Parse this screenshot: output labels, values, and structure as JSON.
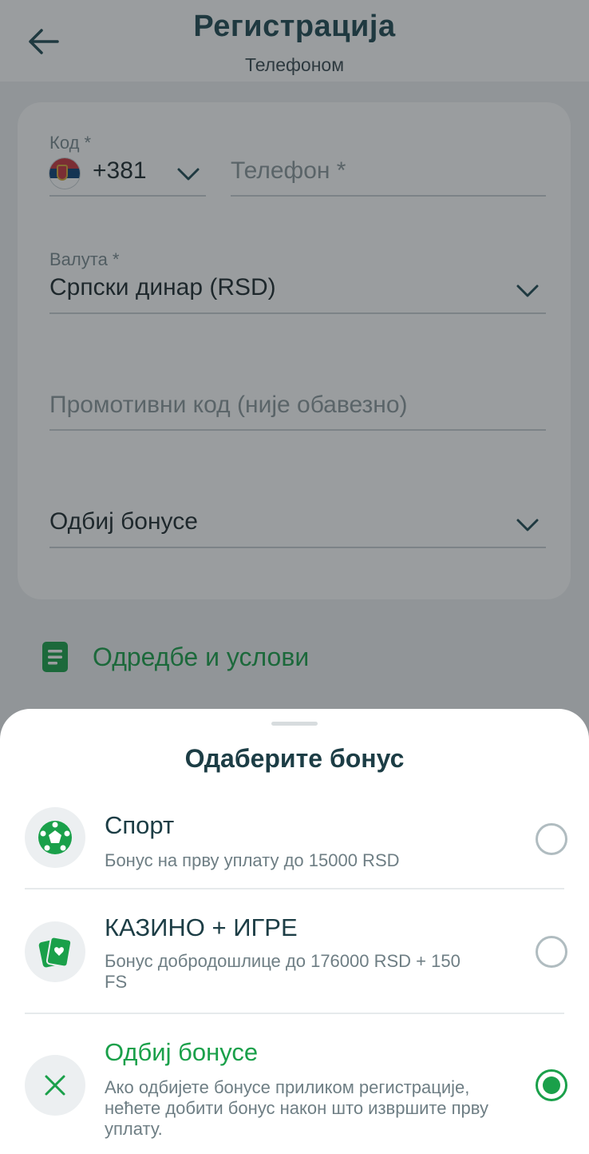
{
  "header": {
    "title": "Регистрација",
    "subtitle": "Телефоном"
  },
  "form": {
    "code_label": "Код *",
    "code_value": "+381",
    "phone_placeholder": "Телефон *",
    "currency_label": "Валута *",
    "currency_value": "Српски динар (RSD)",
    "promo_placeholder": "Промотивни код (није обавезно)",
    "bonus_value": "Одбиј бонусе"
  },
  "terms": {
    "label": "Одредбе и услови"
  },
  "sheet": {
    "title": "Одаберите бонус",
    "options": [
      {
        "title": "Спорт",
        "description": "Бонус на прву уплату до 15000 RSD",
        "icon": "soccer-ball-icon",
        "selected": false
      },
      {
        "title": "КАЗИНО + ИГРЕ",
        "description": "Бонус добродошлице до 176000 RSD + 150 FS",
        "icon": "cards-icon",
        "selected": false
      },
      {
        "title": "Одбиј бонусе",
        "description": "Ако одбијете бонусе приликом регистрације, нећете добити бонус након што извршите прву уплату.",
        "icon": "close-icon",
        "selected": true
      }
    ]
  },
  "colors": {
    "accent_green": "#1aa04a",
    "title_dark": "#1c3d45",
    "overlay": "rgba(30,38,42,0.45)"
  }
}
